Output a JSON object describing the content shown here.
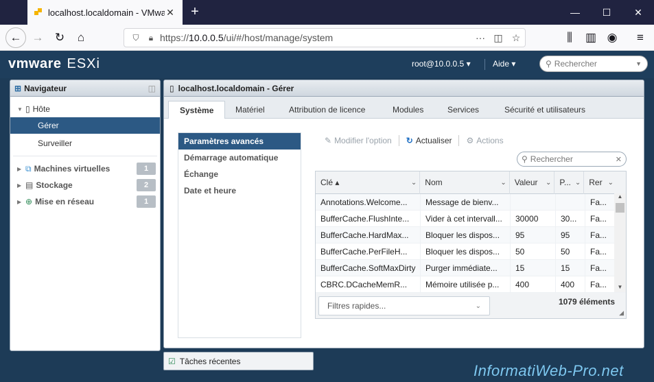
{
  "browser": {
    "tab_title": "localhost.localdomain - VMwa",
    "url_prefix": "https://",
    "url_host": "10.0.0.5",
    "url_path": "/ui/#/host/manage/system"
  },
  "esxi": {
    "logo_brand": "vmware",
    "logo_product": "ESXi",
    "user": "root@10.0.0.5 ▾",
    "help": "Aide ▾",
    "search_placeholder": "Rechercher"
  },
  "navigator": {
    "title": "Navigateur",
    "host_label": "Hôte",
    "manage": "Gérer",
    "monitor": "Surveiller",
    "items": [
      {
        "label": "Machines virtuelles",
        "count": "1"
      },
      {
        "label": "Stockage",
        "count": "2"
      },
      {
        "label": "Mise en réseau",
        "count": "1"
      }
    ]
  },
  "main": {
    "title": "localhost.localdomain - Gérer",
    "tabs": [
      "Système",
      "Matériel",
      "Attribution de licence",
      "Modules",
      "Services",
      "Sécurité et utilisateurs"
    ],
    "menu": [
      "Paramètres avancés",
      "Démarrage automatique",
      "Échange",
      "Date et heure"
    ],
    "toolbar": {
      "edit": "Modifier l'option",
      "refresh": "Actualiser",
      "actions": "Actions"
    },
    "search_placeholder": "Rechercher",
    "columns": [
      "Clé ▴",
      "Nom",
      "Valeur",
      "P...",
      "Rer"
    ],
    "rows": [
      [
        "Annotations.Welcome...",
        "Message de bienv...",
        "",
        "",
        "Fa..."
      ],
      [
        "BufferCache.FlushInte...",
        "Vider à cet intervall...",
        "30000",
        "30...",
        "Fa..."
      ],
      [
        "BufferCache.HardMax...",
        "Bloquer les dispos...",
        "95",
        "95",
        "Fa..."
      ],
      [
        "BufferCache.PerFileH...",
        "Bloquer les dispos...",
        "50",
        "50",
        "Fa..."
      ],
      [
        "BufferCache.SoftMaxDirty",
        "Purger immédiate...",
        "15",
        "15",
        "Fa..."
      ],
      [
        "CBRC.DCacheMemR...",
        "Mémoire utilisée p...",
        "400",
        "400",
        "Fa..."
      ]
    ],
    "quick_filters": "Filtres rapides...",
    "count": "1079 éléments"
  },
  "recent_tasks": "Tâches récentes",
  "watermark": "InformatiWeb-Pro.net"
}
